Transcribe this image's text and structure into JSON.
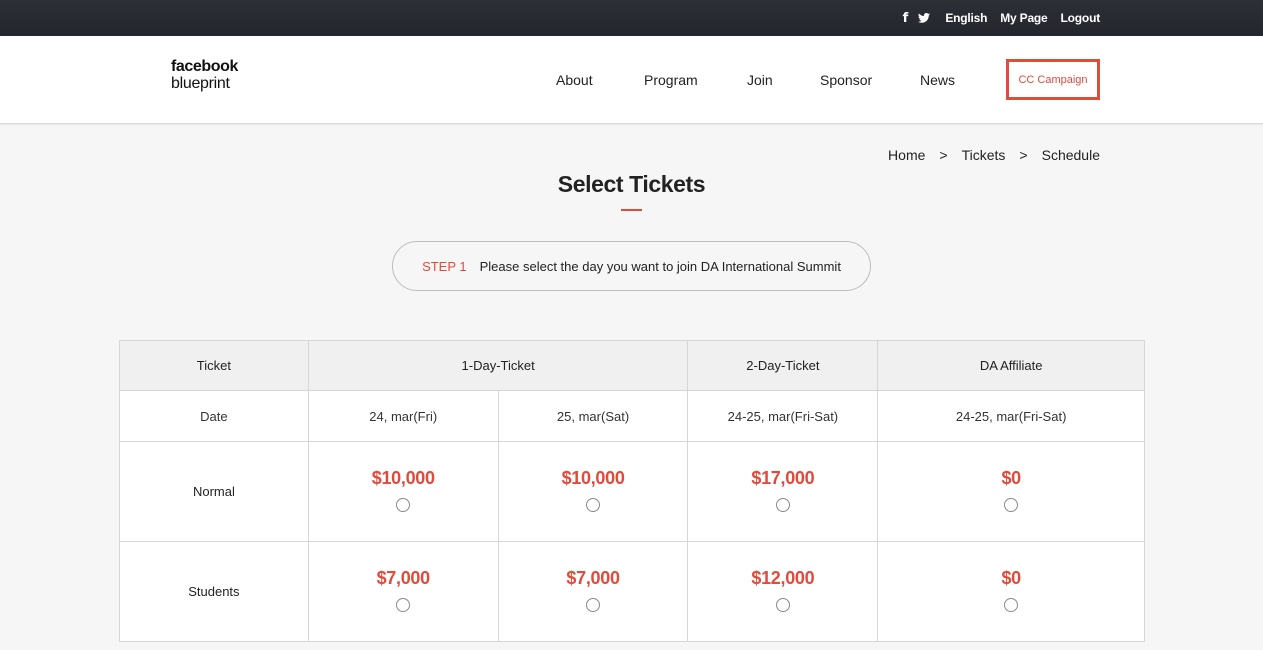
{
  "topbar": {
    "social": [
      "facebook-icon",
      "twitter-icon"
    ],
    "links": [
      "English",
      "My Page",
      "Logout"
    ]
  },
  "brand": {
    "line1": "facebook",
    "line2": "blueprint"
  },
  "nav": {
    "items": [
      "About",
      "Program",
      "Join",
      "Sponsor",
      "News"
    ],
    "cta": "CC Campaign"
  },
  "breadcrumb": [
    "Home",
    "Tickets",
    "Schedule"
  ],
  "breadcrumb_separator": ">",
  "page_title": "Select Tickets",
  "step": {
    "number": "STEP 1",
    "message": "Please select the day you want to join DA International Summit"
  },
  "colors": {
    "accent": "#e24b3b",
    "topbar": "#2c2f36"
  },
  "table": {
    "headers": [
      "Ticket",
      "1-Day-Ticket",
      "2-Day-Ticket",
      "DA Affiliate"
    ],
    "date_label": "Date",
    "dates": [
      "24, mar(Fri)",
      "25, mar(Sat)",
      "24-25, mar(Fri-Sat)",
      "24-25, mar(Fri-Sat)"
    ],
    "rows": [
      {
        "label": "Normal",
        "prices": [
          "$10,000",
          "$10,000",
          "$17,000",
          "$0"
        ]
      },
      {
        "label": "Students",
        "prices": [
          "$7,000",
          "$7,000",
          "$12,000",
          "$0"
        ]
      }
    ]
  }
}
